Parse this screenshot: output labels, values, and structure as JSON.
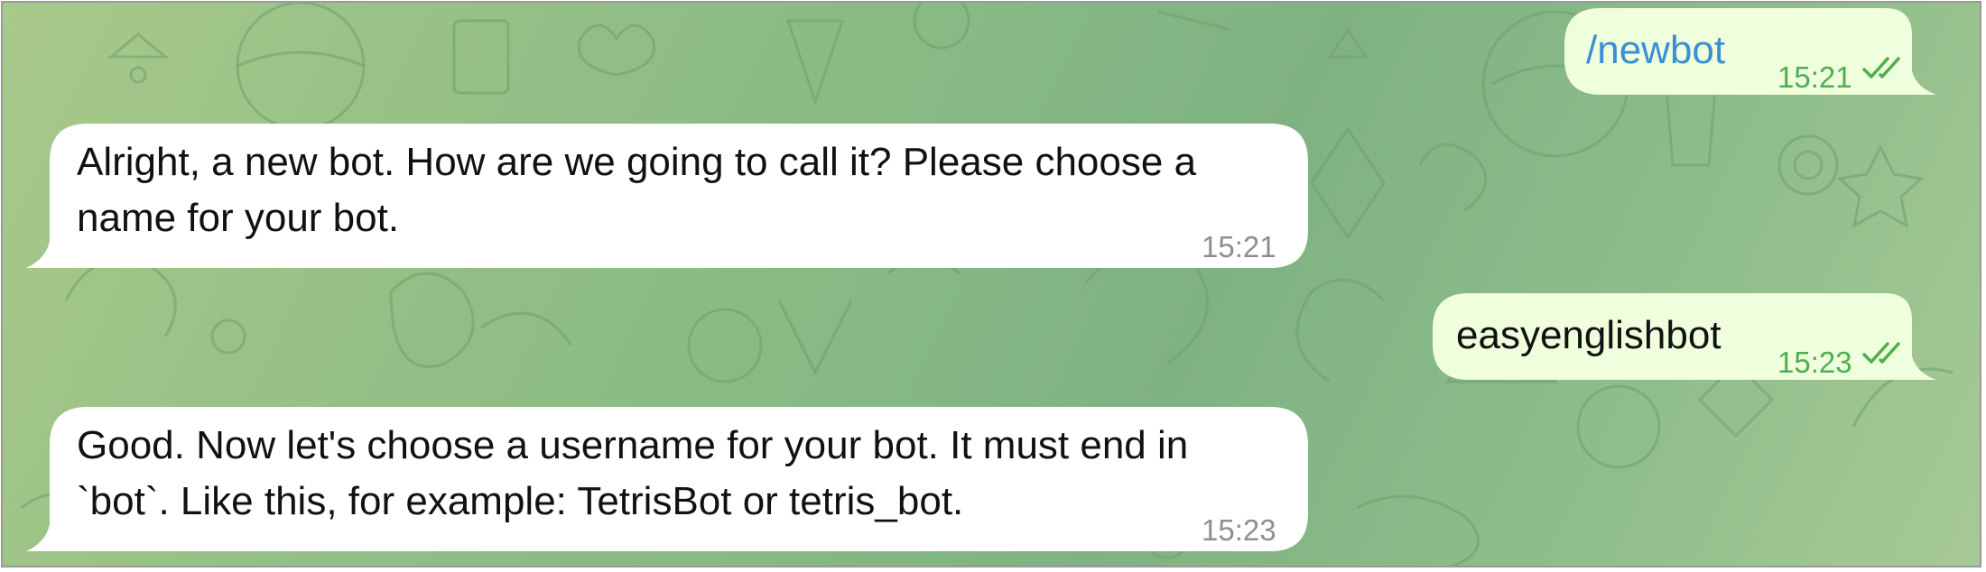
{
  "messages": [
    {
      "direction": "outgoing",
      "text": "/newbot",
      "time": "15:21",
      "is_command": true
    },
    {
      "direction": "incoming",
      "line1": "Alright, a new bot. How are we going to call it? Please choose a",
      "line2": "name for your bot.",
      "time": "15:21"
    },
    {
      "direction": "outgoing",
      "text": "easyenglishbot",
      "time": "15:23",
      "is_command": false
    },
    {
      "direction": "incoming",
      "line1": "Good. Now let's choose a username for your bot. It must end in",
      "line2": "`bot`. Like this, for example: TetrisBot or tetris_bot.",
      "time": "15:23"
    }
  ],
  "colors": {
    "incoming_bubble": "#ffffff",
    "outgoing_bubble": "#effedd",
    "command_link": "#3a8fd6",
    "outgoing_time": "#4fae4e",
    "incoming_time": "#8f8f8f"
  },
  "icons": {
    "read_receipt": "double-check-icon"
  }
}
